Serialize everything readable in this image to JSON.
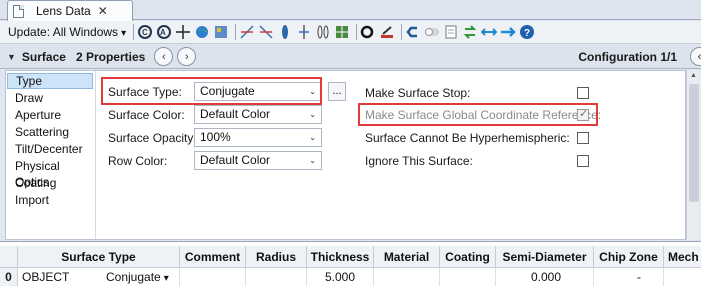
{
  "tab": {
    "title": "Lens Data",
    "close_glyph": "✕"
  },
  "toolbar": {
    "update_label": "Update: All Windows",
    "update_caret": "▾"
  },
  "props_bar": {
    "surface_label": "Surface",
    "properties_label": "2 Properties",
    "prev_glyph": "‹",
    "next_glyph": "›",
    "configuration_label": "Configuration 1/1",
    "collapse_glyph": "▼"
  },
  "categories": [
    "Type",
    "Draw",
    "Aperture",
    "Scattering",
    "Tilt/Decenter",
    "Physical Optics",
    "Coating",
    "Import"
  ],
  "selected_category": "Type",
  "form": {
    "surface_type": {
      "label": "Surface Type:",
      "value": "Conjugate"
    },
    "surface_color": {
      "label": "Surface Color:",
      "value": "Default Color"
    },
    "surface_opacity": {
      "label": "Surface Opacity:",
      "value": "100%"
    },
    "row_color": {
      "label": "Row Color:",
      "value": "Default Color"
    },
    "ellipsis_label": "...",
    "caret": "⌄",
    "make_stop": {
      "label": "Make Surface Stop:",
      "checked": false
    },
    "make_global_ref": {
      "label": "Make Surface Global Coordinate Reference:",
      "checked": true,
      "disabled": true
    },
    "hyperhemispheric": {
      "label": "Surface Cannot Be Hyperhemispheric:",
      "checked": false
    },
    "ignore_surface": {
      "label": "Ignore This Surface:",
      "checked": false
    },
    "check_glyph": "✓"
  },
  "grid": {
    "columns": [
      "Surface Type",
      "Comment",
      "Radius",
      "Thickness",
      "Material",
      "Coating",
      "Semi-Diameter",
      "Chip Zone",
      "Mech"
    ],
    "row": {
      "index": "0",
      "name": "OBJECT",
      "type": "Conjugate",
      "type_caret": "▾",
      "thickness": "5.000",
      "semi_diameter": "0.000",
      "chip_zone": "-"
    }
  },
  "colors": {
    "highlight": "#e03a3a",
    "selection": "#cde3f8"
  },
  "icons": [
    "document-icon",
    "refresh-icon",
    "clear-icon",
    "crosshair-icon",
    "globe-icon",
    "layout-icon",
    "reverse-icon",
    "flip-icon",
    "lens-icon",
    "split-icon",
    "circle-icon",
    "brush-icon",
    "back-icon",
    "toggle-icon",
    "page-icon",
    "convert-icon",
    "arrows-icon",
    "arrow-right-icon",
    "help-icon"
  ]
}
